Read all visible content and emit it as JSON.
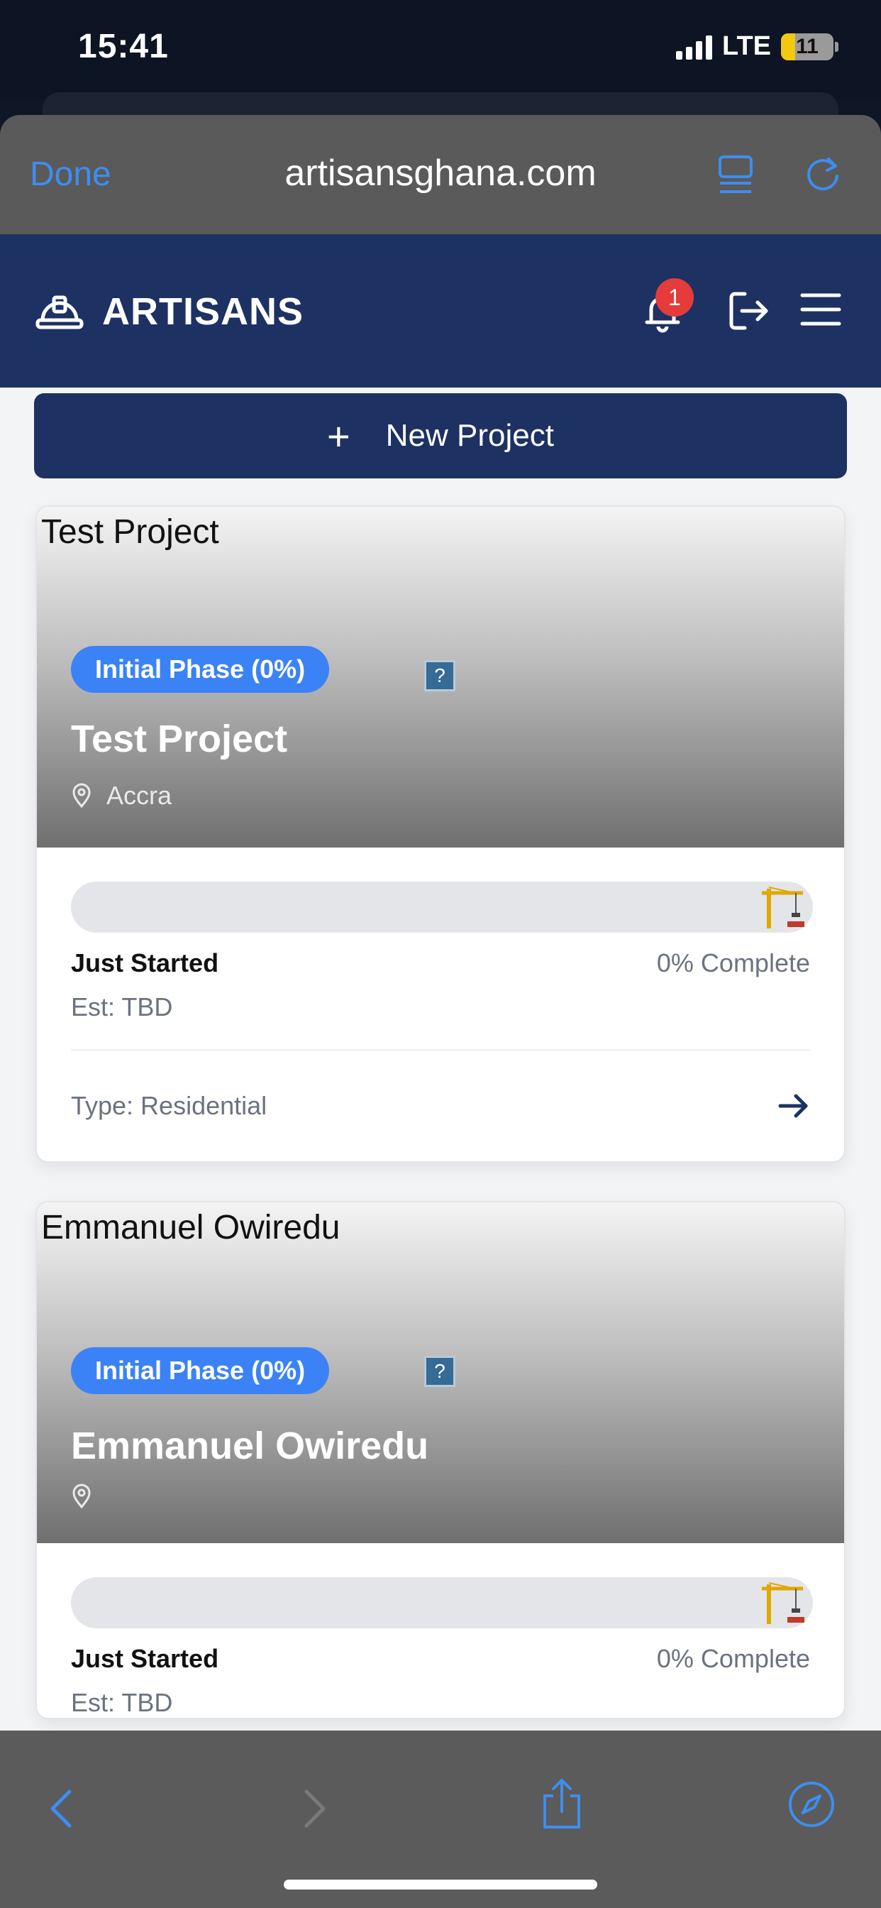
{
  "status": {
    "time": "15:41",
    "network": "LTE",
    "battery": "11"
  },
  "browser": {
    "done_label": "Done",
    "url": "artisansghana.com"
  },
  "app": {
    "brand": "ARTISANS",
    "notification_count": "1"
  },
  "actions": {
    "new_project": "New Project"
  },
  "projects": [
    {
      "hero_title": "Test Project",
      "phase": "Initial Phase (0%)",
      "name": "Test Project",
      "location": "Accra",
      "progress_percent": 0,
      "status": "Just Started",
      "complete": "0% Complete",
      "est": "Est: TBD",
      "type": "Type: Residential"
    },
    {
      "hero_title": "Emmanuel Owiredu",
      "phase": "Initial Phase (0%)",
      "name": "Emmanuel Owiredu",
      "location": "",
      "progress_percent": 0,
      "status": "Just Started",
      "complete": "0% Complete",
      "est": "Est: TBD",
      "type": ""
    }
  ],
  "colors": {
    "primary": "#1d3163",
    "accent": "#3b82f6",
    "badge": "#e53b3b",
    "browser_blue": "#3d8ef0"
  },
  "icons": {
    "brand": "hard-hat-icon",
    "notifications": "bell-icon",
    "logout": "logout-icon",
    "menu": "hamburger-menu-icon",
    "progress_marker": "crane-icon"
  }
}
